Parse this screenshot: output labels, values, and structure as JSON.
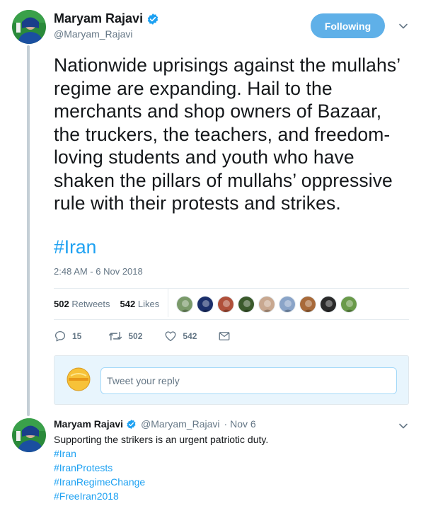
{
  "tweet": {
    "author_name": "Maryam Rajavi",
    "author_handle": "@Maryam_Rajavi",
    "follow_label": "Following",
    "text": "Nationwide uprisings against the mullahs’ regime are expanding. Hail to the merchants and shop owners of Bazaar, the truckers, the teachers, and freedom-loving students and youth who have shaken the pillars of mullahs’ oppressive rule with their protests and strikes.",
    "hashtag": "#Iran",
    "timestamp": "2:48 AM - 6 Nov 2018",
    "retweets_count": "502",
    "retweets_label": "Retweets",
    "likes_count": "542",
    "likes_label": "Likes",
    "likers": [
      {
        "icon": "liker-avatar-1",
        "color": "#7a9a6a"
      },
      {
        "icon": "liker-avatar-2",
        "color": "#1b2f6b"
      },
      {
        "icon": "liker-avatar-3",
        "color": "#b0503a"
      },
      {
        "icon": "liker-avatar-4",
        "color": "#3b5a2c"
      },
      {
        "icon": "liker-avatar-5",
        "color": "#c8a890"
      },
      {
        "icon": "liker-avatar-6",
        "color": "#8aa4c8"
      },
      {
        "icon": "liker-avatar-7",
        "color": "#a86a3a"
      },
      {
        "icon": "liker-avatar-8",
        "color": "#2a2a2a"
      },
      {
        "icon": "liker-avatar-9",
        "color": "#6a9a4a"
      }
    ],
    "actions": {
      "reply_count": "15",
      "retweet_count": "502",
      "like_count": "542"
    }
  },
  "reply_box": {
    "placeholder": "Tweet your reply"
  },
  "reply": {
    "author_name": "Maryam Rajavi",
    "author_handle": "@Maryam_Rajavi",
    "date": "· Nov 6",
    "text": "Supporting the strikers is an urgent patriotic duty.",
    "hashtags": [
      "#Iran",
      "#IranProtests",
      "#IranRegimeChange",
      "#FreeIran2018"
    ]
  },
  "colors": {
    "accent": "#1da1f2",
    "follow_button": "#5fb0e8",
    "secondary_text": "#657786",
    "reply_box_bg": "#e8f5fd"
  }
}
